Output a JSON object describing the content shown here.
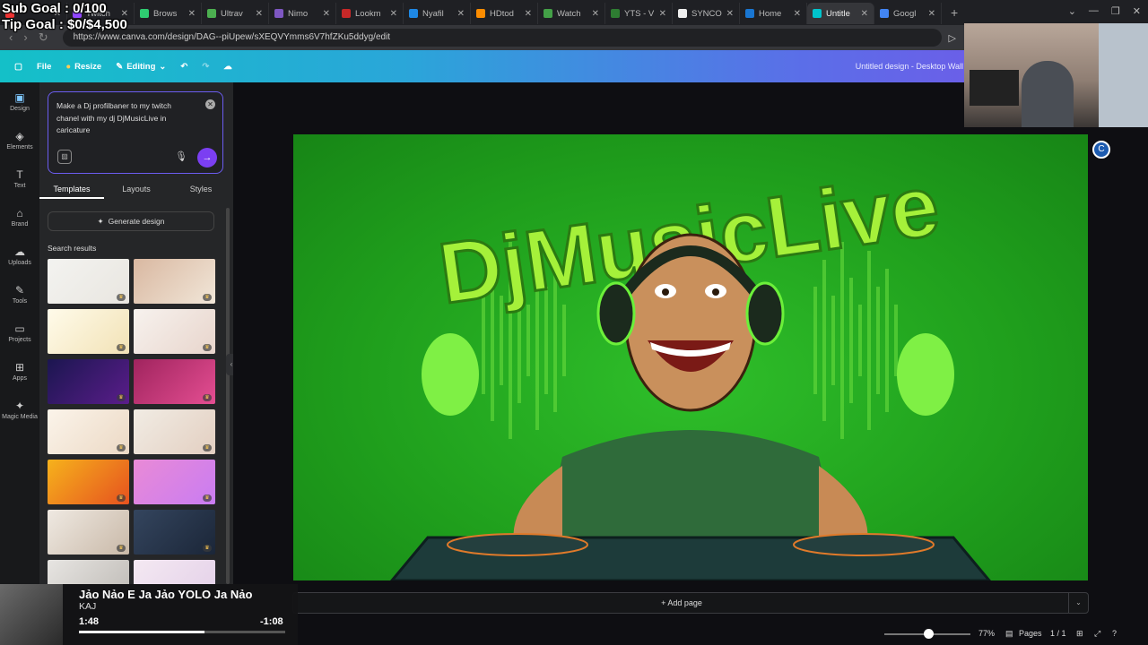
{
  "goals": {
    "sub": "Sub Goal : 0/100",
    "tip": "Tip Goal : $0/$4,500"
  },
  "tabs": [
    {
      "label": "",
      "color": "#e33"
    },
    {
      "label": "Twitch",
      "color": "#9146ff"
    },
    {
      "label": "Brows",
      "color": "#2ecc71"
    },
    {
      "label": "Ultrav",
      "color": "#4caf50"
    },
    {
      "label": "Nimo",
      "color": "#7e57c2"
    },
    {
      "label": "Lookm",
      "color": "#c62828"
    },
    {
      "label": "Nyafil",
      "color": "#1e88e5"
    },
    {
      "label": "HDtod",
      "color": "#fb8c00"
    },
    {
      "label": "Watch",
      "color": "#43a047"
    },
    {
      "label": "YTS - V",
      "color": "#2e7d32"
    },
    {
      "label": "SYNCO",
      "color": "#eee"
    },
    {
      "label": "Home",
      "color": "#1976d2"
    },
    {
      "label": "Untitle",
      "color": "#00c4cc"
    },
    {
      "label": "Googl",
      "color": "#4285f4"
    }
  ],
  "address": {
    "url": "https://www.canva.com/design/DAG--piUpew/sXEQVYmms6V7hfZKu5ddyg/edit"
  },
  "header": {
    "file": "File",
    "resize": "Resize",
    "editing": "Editing",
    "title": "Untitled design - Desktop Wall"
  },
  "rail": [
    {
      "label": "Design",
      "icon": "▣"
    },
    {
      "label": "Elements",
      "icon": "◈"
    },
    {
      "label": "Text",
      "icon": "T"
    },
    {
      "label": "Brand",
      "icon": "⌂"
    },
    {
      "label": "Uploads",
      "icon": "☁"
    },
    {
      "label": "Tools",
      "icon": "✎"
    },
    {
      "label": "Projects",
      "icon": "▭"
    },
    {
      "label": "Apps",
      "icon": "⊞"
    },
    {
      "label": "Magic Media",
      "icon": "✦"
    }
  ],
  "prompt": {
    "text": "Make a Dj profilbaner to my twitch chanel with my dj DjMusicLive in caricature"
  },
  "panel_tabs": [
    "Templates",
    "Layouts",
    "Styles"
  ],
  "generate": "Generate design",
  "results_label": "Search results",
  "thumb_colors": [
    [
      "#f3f3f0",
      "#e9e6e0"
    ],
    [
      "#d9b8a1",
      "#f1e6d8"
    ],
    [
      "#fffbea",
      "#f2e2b6"
    ],
    [
      "#f7f2ee",
      "#e8d5cc"
    ],
    [
      "#1b1650",
      "#5a1d8a"
    ],
    [
      "#a0245e",
      "#e44e92"
    ],
    [
      "#fbf4ea",
      "#ecd9c5"
    ],
    [
      "#f1ece4",
      "#e3cfc1"
    ],
    [
      "#f6b21c",
      "#e6521f"
    ],
    [
      "#e98ad6",
      "#c97cf2"
    ],
    [
      "#efe9e2",
      "#c9b9a8"
    ],
    [
      "#34455e",
      "#1b2638"
    ],
    [
      "#e7e5e2",
      "#bdb9b4"
    ],
    [
      "#f4e9f2",
      "#e3cfe8"
    ]
  ],
  "design": {
    "brand": "DjMusicLive"
  },
  "add_page": "+ Add page",
  "footer": {
    "zoom": "77%",
    "pages": "Pages",
    "page_count": "1 / 1"
  },
  "music": {
    "title": "Jảo Nảo E Ja Jảo YOLO Ja Nảo",
    "artist": "KAJ",
    "elapsed": "1:48",
    "remaining": "-1:08",
    "progress": 0.61
  }
}
